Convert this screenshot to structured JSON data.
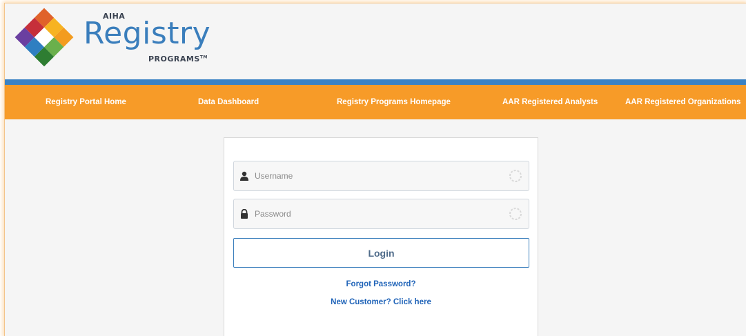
{
  "logo": {
    "small_top": "AIHA",
    "main": "Registry",
    "small_bottom": "PROGRAMS",
    "trademark": "TM"
  },
  "colors": {
    "brand_blue": "#3a82c4",
    "nav_orange": "#f79b28",
    "link_blue": "#1f63b8"
  },
  "nav": {
    "items": [
      {
        "label": "Registry Portal Home"
      },
      {
        "label": "Data Dashboard"
      },
      {
        "label": "Registry Programs Homepage"
      },
      {
        "label": "AAR Registered Analysts"
      },
      {
        "label": "AAR Registered Organizations"
      }
    ]
  },
  "login": {
    "username_placeholder": "Username",
    "username_icon": "user-icon",
    "password_placeholder": "Password",
    "password_icon": "lock-icon",
    "button_label": "Login",
    "forgot_link": "Forgot Password?",
    "new_customer_link": "New Customer? Click here"
  }
}
